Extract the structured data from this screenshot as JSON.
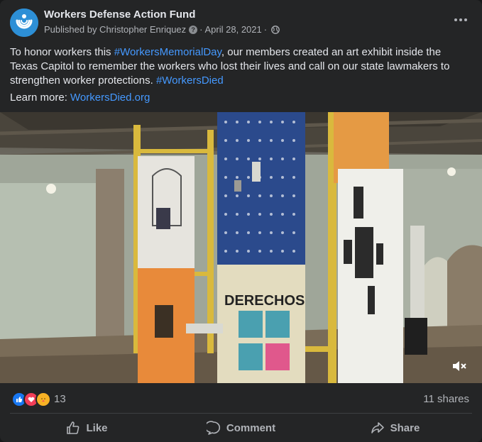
{
  "post": {
    "page_name": "Workers Defense Action Fund",
    "published_by": "Published by Christopher Enriquez",
    "date": "April 28, 2021",
    "separator": "·",
    "info_glyph": "?",
    "text_before": "To honor workers this ",
    "hashtag1": "#WorkersMemorialDay",
    "text_middle": ", our members created an art exhibit inside the Texas Capitol to remember the workers who lost their lives and call on our state lawmakers to strengthen worker protections. ",
    "hashtag2": "#WorkersDied",
    "learn_label": "Learn more: ",
    "learn_link": "WorkersDied.org",
    "video_banner_text": "DERECHOS",
    "reaction_count": "13",
    "shares": "11 shares",
    "reactions": [
      "like-icon",
      "love-icon",
      "care-icon"
    ]
  },
  "actions": {
    "like": "Like",
    "comment": "Comment",
    "share": "Share"
  },
  "colors": {
    "background": "#242526",
    "link": "#4599ff",
    "avatar": "#2d8fd6",
    "like": "#1877f2",
    "love": "#f33e58",
    "care": "#f7b125"
  }
}
